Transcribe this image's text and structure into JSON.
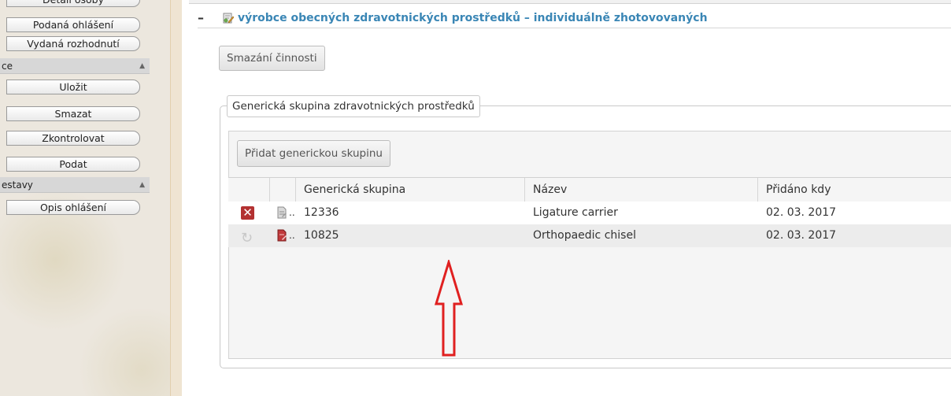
{
  "sidebar": {
    "top_button_partial": "Detail osoby",
    "buttons_top": [
      "Podaná ohlášení",
      "Vydaná rozhodnutí"
    ],
    "section_actions": {
      "label": "ce",
      "buttons": [
        "Uložit",
        "Smazat",
        "Zkontrolovat",
        "Podat"
      ]
    },
    "section_reports": {
      "label": "estavy",
      "buttons": [
        "Opis ohlášení"
      ]
    }
  },
  "section": {
    "toggle": "–",
    "title": "výrobce obecných zdravotnických prostředků – individuálně zhotovovaných",
    "delete_activity_button": "Smazání činnosti"
  },
  "fieldset": {
    "legend": "Generická skupina zdravotnických prostředků",
    "add_button": "Přidat generickou skupinu"
  },
  "table": {
    "columns": [
      "",
      "",
      "Generická skupina",
      "Název",
      "Přidáno kdy"
    ],
    "rows": [
      {
        "action_icon": "delete-icon",
        "doc_icon": "document-icon",
        "doc_text": "..",
        "group": "12336",
        "name": "Ligature carrier",
        "added": "02. 03. 2017"
      },
      {
        "action_icon": "restore-icon",
        "doc_icon": "document-deleted-icon",
        "doc_text": "..",
        "group": "10825",
        "name": "Orthopaedic chisel",
        "added": "02. 03. 2017"
      }
    ]
  },
  "colors": {
    "title_blue": "#3a86b5",
    "delete_red": "#b33131",
    "annotation_red": "#e02020",
    "sidebar_header": "#d7d7d7"
  }
}
